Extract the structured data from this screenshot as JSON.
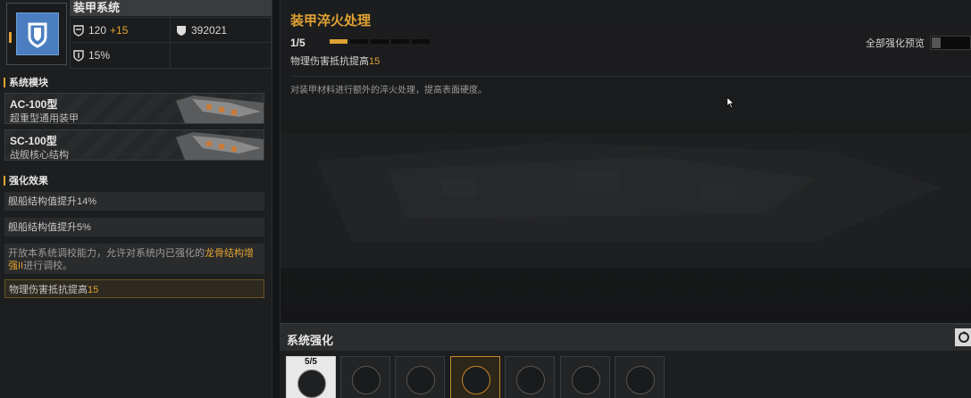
{
  "system": {
    "title": "装甲系统",
    "stats": {
      "armor_value": "120",
      "armor_bonus": "+15",
      "structure_value": "392021",
      "resist_value": "15%"
    }
  },
  "modules": {
    "heading": "系统模块",
    "items": [
      {
        "code": "AC-100型",
        "desc": "超重型通用装甲"
      },
      {
        "code": "SC-100型",
        "desc": "战舰核心结构"
      }
    ]
  },
  "effects": {
    "heading": "强化效果",
    "items": [
      {
        "text": "舰船结构值提升14%"
      },
      {
        "text": "舰船结构值提升5%"
      },
      {
        "pre": "开放本系统调校能力，允许对系统内已强化的",
        "link": "龙骨结构增强II",
        "post": "进行调校。"
      },
      {
        "pre": "物理伤害抵抗提高",
        "value": "15"
      }
    ]
  },
  "detail": {
    "title": "装甲淬火处理",
    "level": "1/5",
    "level_current": 1,
    "level_max": 5,
    "effect_pre": "物理伤害抵抗提高",
    "effect_value": "15",
    "description": "对装甲材料进行额外的淬火处理，提高表面硬度。",
    "preview_label": "全部强化预览",
    "preview_enabled": false
  },
  "enhance": {
    "heading": "系统强化",
    "slots": [
      {
        "level": "5/5",
        "icon": "ship-emblem-icon"
      },
      {
        "icon": "ship-emblem-icon"
      },
      {
        "icon": "arrow-emblem-icon"
      },
      {
        "icon": "arrow-emblem-icon"
      },
      {
        "icon": "flame-emblem-icon"
      },
      {
        "icon": "anchor-emblem-icon"
      },
      {
        "icon": "gear-emblem-icon"
      }
    ]
  },
  "colors": {
    "accent": "#e0a233",
    "icon_blue": "#4a7ec0"
  }
}
